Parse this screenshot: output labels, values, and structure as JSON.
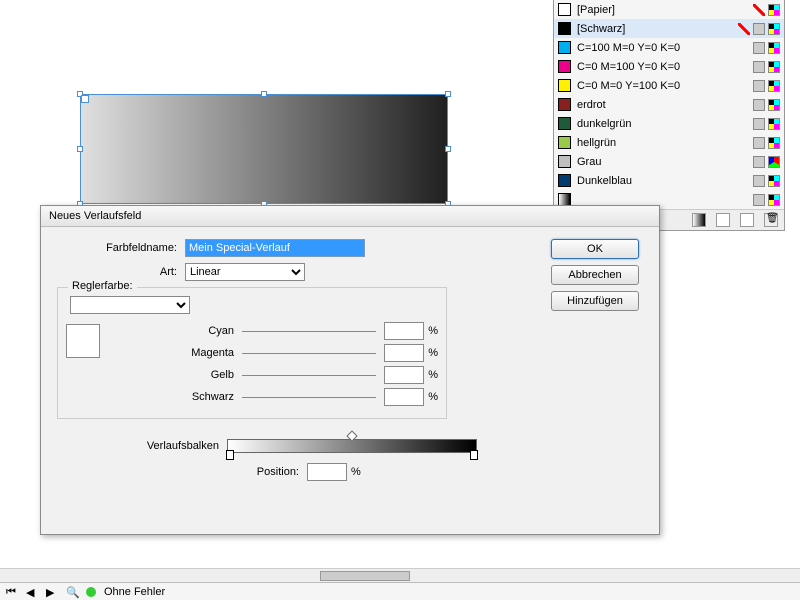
{
  "swatches": {
    "items": [
      {
        "name": "[Papier]",
        "color": "#ffffff",
        "icons": [
          "no",
          "cmyk"
        ]
      },
      {
        "name": "[Schwarz]",
        "color": "#000000",
        "icons": [
          "no",
          "gray",
          "cmyk"
        ],
        "sel": true
      },
      {
        "name": "C=100 M=0 Y=0 K=0",
        "color": "#00aeef",
        "icons": [
          "gray",
          "cmyk"
        ]
      },
      {
        "name": "C=0 M=100 Y=0 K=0",
        "color": "#ec008c",
        "icons": [
          "gray",
          "cmyk"
        ]
      },
      {
        "name": "C=0 M=0 Y=100 K=0",
        "color": "#fff200",
        "icons": [
          "gray",
          "cmyk"
        ]
      },
      {
        "name": "erdrot",
        "color": "#8a1f1f",
        "icons": [
          "gray",
          "cmyk"
        ]
      },
      {
        "name": "dunkelgrün",
        "color": "#1f5a3a",
        "icons": [
          "gray",
          "cmyk"
        ]
      },
      {
        "name": "hellgrün",
        "color": "#9ac84a",
        "icons": [
          "gray",
          "cmyk"
        ]
      },
      {
        "name": "Grau",
        "color": "#bfbfbf",
        "icons": [
          "gray",
          "rgb"
        ]
      },
      {
        "name": "Dunkelblau",
        "color": "#003a70",
        "icons": [
          "gray",
          "cmyk"
        ]
      },
      {
        "name": "",
        "color": "grad",
        "icons": [
          "gray",
          "cmyk"
        ]
      }
    ]
  },
  "dialog": {
    "title": "Neues Verlaufsfeld",
    "name_label": "Farbfeldname:",
    "name_value": "Mein Special-Verlauf",
    "type_label": "Art:",
    "type_value": "Linear",
    "group_label": "Reglerfarbe:",
    "channels": {
      "cyan": "Cyan",
      "magenta": "Magenta",
      "gelb": "Gelb",
      "schwarz": "Schwarz"
    },
    "pct": "%",
    "grad_label": "Verlaufsbalken",
    "pos_label": "Position:",
    "buttons": {
      "ok": "OK",
      "cancel": "Abbrechen",
      "add": "Hinzufügen"
    }
  },
  "status": {
    "text": "Ohne Fehler"
  }
}
